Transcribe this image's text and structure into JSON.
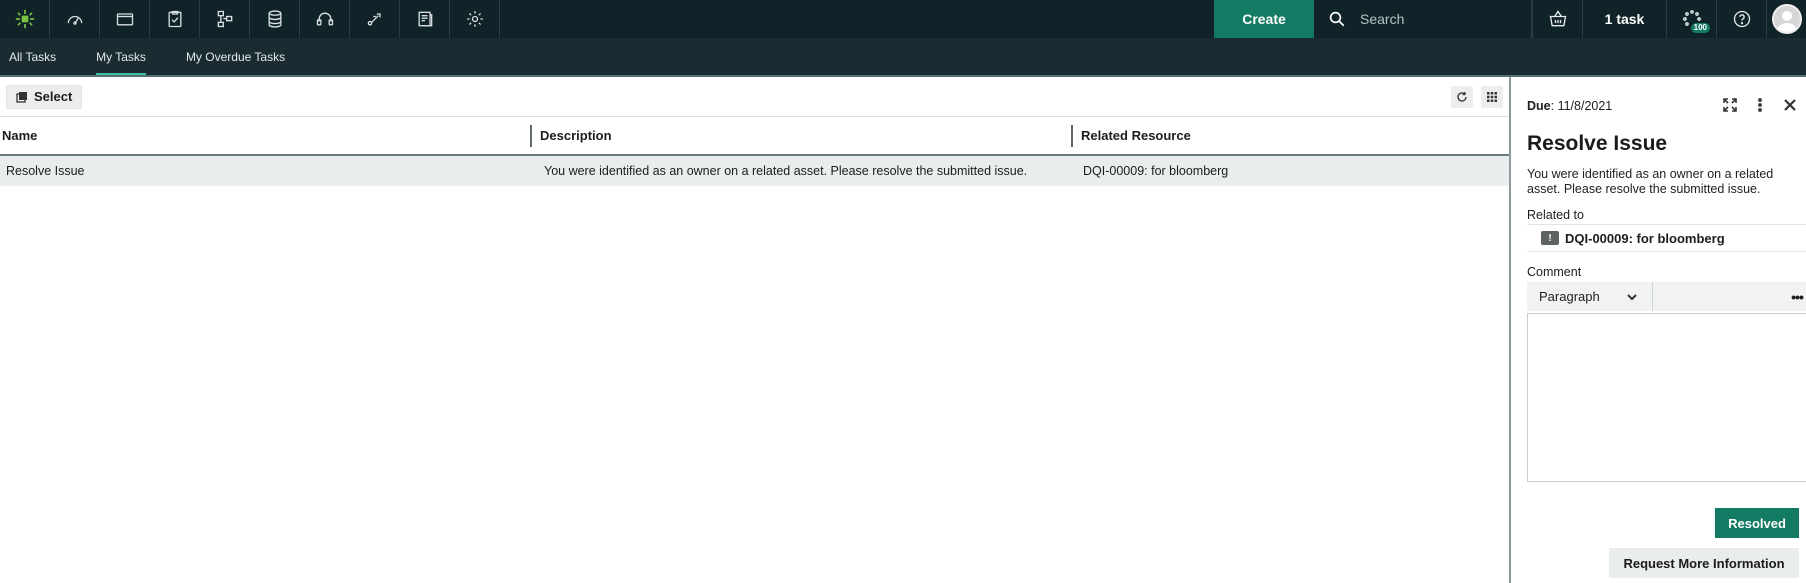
{
  "topbar": {
    "create_label": "Create",
    "search_placeholder": "Search",
    "task_count_label": "1 task",
    "notification_badge": "100",
    "nav_icons": [
      "logo-icon",
      "dashboard-icon",
      "folder-icon",
      "clipboard-check-icon",
      "hierarchy-icon",
      "database-icon",
      "headset-icon",
      "workflow-icon",
      "report-icon",
      "gear-icon"
    ]
  },
  "subnav": {
    "tabs": [
      {
        "label": "All Tasks",
        "active": false
      },
      {
        "label": "My Tasks",
        "active": true
      },
      {
        "label": "My Overdue Tasks",
        "active": false
      }
    ]
  },
  "list": {
    "select_label": "Select",
    "columns": [
      "Name",
      "Description",
      "Related Resource"
    ],
    "rows": [
      {
        "name": "Resolve Issue",
        "description": "You were identified as an owner on a related asset. Please resolve the submitted issue.",
        "related_resource": "DQI-00009: for bloomberg"
      }
    ]
  },
  "panel": {
    "due_label": "Due",
    "due_date": ": 11/8/2021",
    "title": "Resolve Issue",
    "description": "You were identified as an owner on a related asset. Please resolve the submitted issue.",
    "related_label": "Related to",
    "related_resource": "DQI-00009: for bloomberg",
    "comment_label": "Comment",
    "paragraph_label": "Paragraph",
    "more_label": "•••",
    "resolved_label": "Resolved",
    "request_info_label": "Request More Information"
  },
  "colors": {
    "topbar_bg": "#0f2328",
    "subnav_bg": "#1a2c31",
    "accent_green": "#137a63",
    "row_highlight": "#e7eeed"
  }
}
